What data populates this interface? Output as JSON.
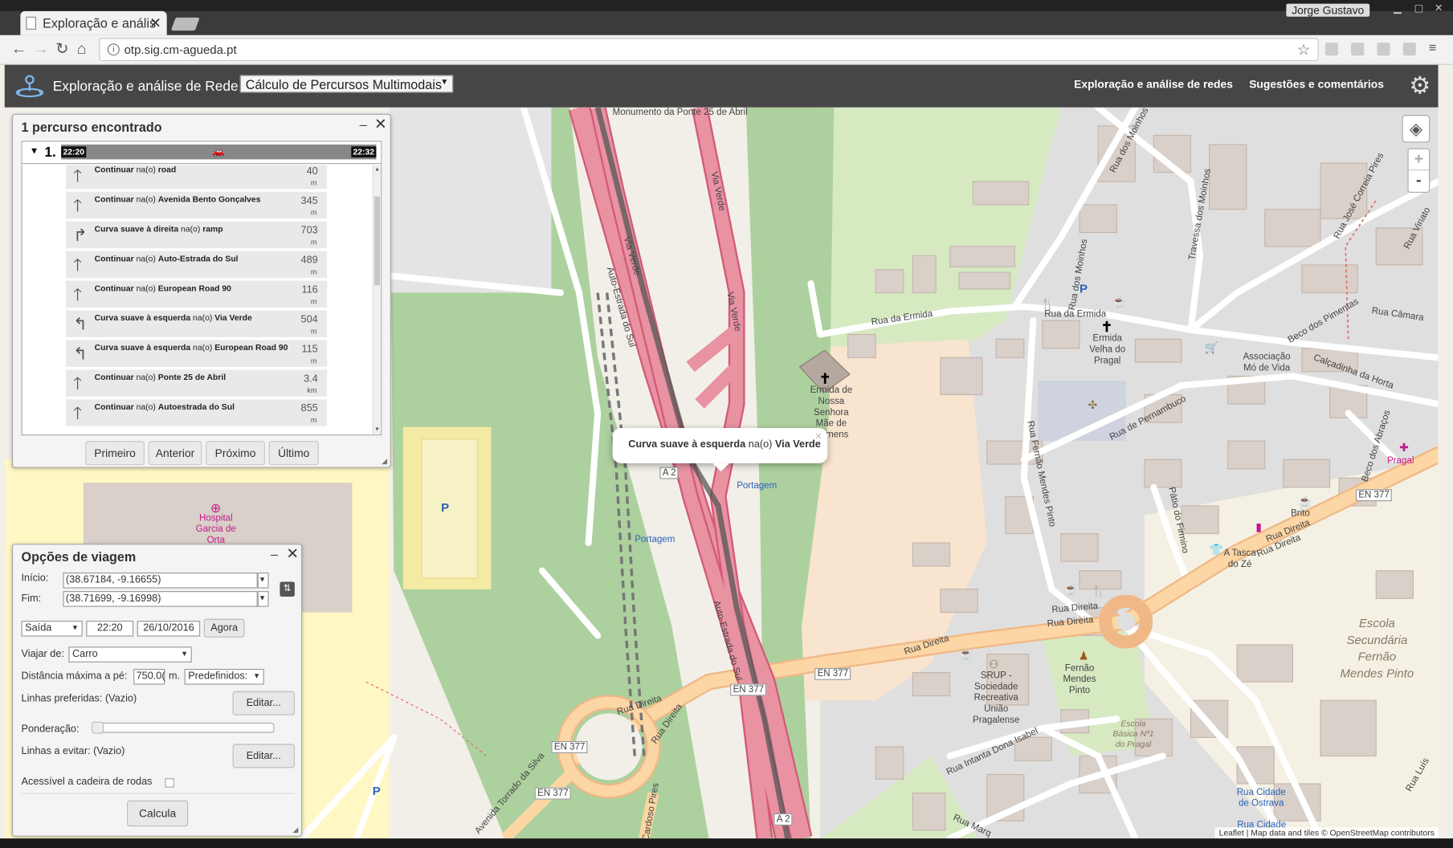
{
  "browser": {
    "tab_title": "Exploração e anális",
    "url": "otp.sig.cm-agueda.pt",
    "user": "Jorge Gustavo"
  },
  "app": {
    "title": "Exploração e análise de Rede",
    "mode": "Cálculo de Percursos Multimodais",
    "nav": [
      "Exploração e análise de redes",
      "Sugestões e comentários"
    ]
  },
  "route_panel": {
    "title": "1 percurso encontrado",
    "itinerary_number": "1.",
    "start_time": "22:20",
    "end_time": "22:32",
    "mode_icon": "car-icon",
    "steps": [
      {
        "action": "Continuar",
        "prep": "na(o)",
        "street": "road",
        "dist": "40",
        "unit": "m",
        "icon": "straight-arrow-icon"
      },
      {
        "action": "Continuar",
        "prep": "na(o)",
        "street": "Avenida Bento Gonçalves",
        "dist": "345",
        "unit": "m",
        "icon": "straight-arrow-icon"
      },
      {
        "action": "Curva suave à direita",
        "prep": "na(o)",
        "street": "ramp",
        "dist": "703",
        "unit": "m",
        "icon": "slight-right-arrow-icon"
      },
      {
        "action": "Continuar",
        "prep": "na(o)",
        "street": "Auto-Estrada do Sul",
        "dist": "489",
        "unit": "m",
        "icon": "straight-arrow-icon"
      },
      {
        "action": "Continuar",
        "prep": "na(o)",
        "street": "European Road 90",
        "dist": "116",
        "unit": "m",
        "icon": "straight-arrow-icon"
      },
      {
        "action": "Curva suave à esquerda",
        "prep": "na(o)",
        "street": "Via Verde",
        "dist": "504",
        "unit": "m",
        "icon": "slight-left-arrow-icon"
      },
      {
        "action": "Curva suave à esquerda",
        "prep": "na(o)",
        "street": "European Road 90",
        "dist": "115",
        "unit": "m",
        "icon": "slight-left-arrow-icon"
      },
      {
        "action": "Continuar",
        "prep": "na(o)",
        "street": "Ponte 25 de Abril",
        "dist": "3.4",
        "unit": "km",
        "icon": "straight-arrow-icon"
      },
      {
        "action": "Continuar",
        "prep": "na(o)",
        "street": "Autoestrada do Sul",
        "dist": "855",
        "unit": "m",
        "icon": "straight-arrow-icon"
      }
    ],
    "pager": [
      "Primeiro",
      "Anterior",
      "Próximo",
      "Último"
    ]
  },
  "options_panel": {
    "title": "Opções de viagem",
    "start_label": "Início:",
    "start_value": "(38.67184, -9.16655)",
    "end_label": "Fim:",
    "end_value": "(38.71699, -9.16998)",
    "depart_select": "Saída",
    "time": "22:20",
    "date": "26/10/2016",
    "now_button": "Agora",
    "travel_label": "Viajar de:",
    "travel_mode": "Carro",
    "walk_label": "Distância máxima a pé:",
    "walk_value": "750.0(",
    "walk_unit": "m.",
    "preset": "Predefinidos:",
    "preferred_label": "Linhas preferidas: (Vazio)",
    "edit_label": "Editar...",
    "weight_label": "Ponderação:",
    "avoid_label": "Linhas a evitar: (Vazio)",
    "wheelchair_label": "Acessível a cadeira de rodas",
    "calc_button": "Calcula"
  },
  "popup": {
    "action": "Curva suave à esquerda",
    "prep": "na(o)",
    "street": "Via Verde"
  },
  "map_labels": {
    "roads": [
      "Rua da Ermida",
      "Rua dos Moinhos",
      "Travessa dos Moinhos",
      "Rua José Correia Pires",
      "Rua Viriato",
      "Beco dos Pimentas",
      "Rua Câmara",
      "Calçadinha da Horta",
      "Rua de Pernambuco",
      "Beco dos Abraços",
      "Rua Fernão Mendes Pinto",
      "Pátio do Firmino",
      "Rua Direita",
      "EN 377",
      "A 2",
      "Via Verde",
      "Auto-Estrada do Sul",
      "Avenida Torrado da Silva",
      "Cardoso Pires",
      "Rua Intanta Dona Isabel",
      "Rua Luís",
      "Rua Marq"
    ],
    "pois": [
      "Ermida de Nossa Senhora Mãe de Homens",
      "Ermida Velha do Pragal",
      "Associação Mó de Vida",
      "Portagem",
      "Hospital Garcia de Orta",
      "SRUP - Sociedade Recreativa União Pragalense",
      "Fernão Mendes Pinto",
      "Escola Secundária Fernão Mendes Pinto",
      "Escola Básica Nº1 do Pragal",
      "A Tasca do Zé",
      "Brito",
      "Pragal",
      "Rua Cidade de Ostrava",
      "Rua Cidade",
      "Monumento da Ponte 25 de Abril"
    ],
    "attribution": "Leaflet | Map data and tiles © OpenStreetMap contributors"
  },
  "colors": {
    "motorway": "#e892a2",
    "trunk": "#f9b29c",
    "primary": "#fcd6a4",
    "forest": "#add19e",
    "building": "#d9d0c9",
    "header": "#464646"
  }
}
